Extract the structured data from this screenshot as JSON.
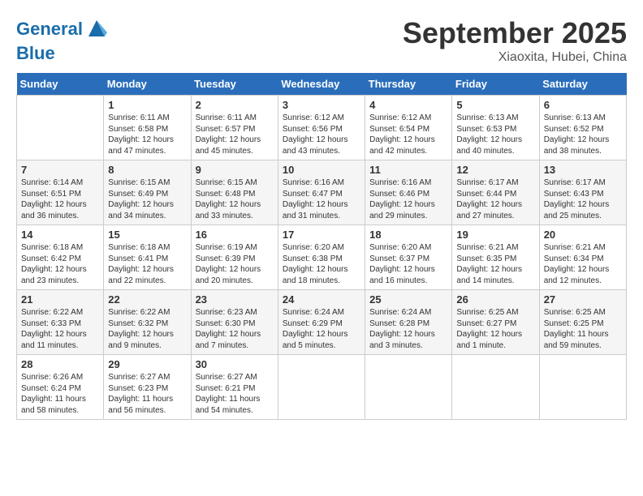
{
  "header": {
    "logo_line1": "General",
    "logo_line2": "Blue",
    "month": "September 2025",
    "location": "Xiaoxita, Hubei, China"
  },
  "days_of_week": [
    "Sunday",
    "Monday",
    "Tuesday",
    "Wednesday",
    "Thursday",
    "Friday",
    "Saturday"
  ],
  "weeks": [
    [
      {
        "num": "",
        "info": ""
      },
      {
        "num": "1",
        "info": "Sunrise: 6:11 AM\nSunset: 6:58 PM\nDaylight: 12 hours\nand 47 minutes."
      },
      {
        "num": "2",
        "info": "Sunrise: 6:11 AM\nSunset: 6:57 PM\nDaylight: 12 hours\nand 45 minutes."
      },
      {
        "num": "3",
        "info": "Sunrise: 6:12 AM\nSunset: 6:56 PM\nDaylight: 12 hours\nand 43 minutes."
      },
      {
        "num": "4",
        "info": "Sunrise: 6:12 AM\nSunset: 6:54 PM\nDaylight: 12 hours\nand 42 minutes."
      },
      {
        "num": "5",
        "info": "Sunrise: 6:13 AM\nSunset: 6:53 PM\nDaylight: 12 hours\nand 40 minutes."
      },
      {
        "num": "6",
        "info": "Sunrise: 6:13 AM\nSunset: 6:52 PM\nDaylight: 12 hours\nand 38 minutes."
      }
    ],
    [
      {
        "num": "7",
        "info": "Sunrise: 6:14 AM\nSunset: 6:51 PM\nDaylight: 12 hours\nand 36 minutes."
      },
      {
        "num": "8",
        "info": "Sunrise: 6:15 AM\nSunset: 6:49 PM\nDaylight: 12 hours\nand 34 minutes."
      },
      {
        "num": "9",
        "info": "Sunrise: 6:15 AM\nSunset: 6:48 PM\nDaylight: 12 hours\nand 33 minutes."
      },
      {
        "num": "10",
        "info": "Sunrise: 6:16 AM\nSunset: 6:47 PM\nDaylight: 12 hours\nand 31 minutes."
      },
      {
        "num": "11",
        "info": "Sunrise: 6:16 AM\nSunset: 6:46 PM\nDaylight: 12 hours\nand 29 minutes."
      },
      {
        "num": "12",
        "info": "Sunrise: 6:17 AM\nSunset: 6:44 PM\nDaylight: 12 hours\nand 27 minutes."
      },
      {
        "num": "13",
        "info": "Sunrise: 6:17 AM\nSunset: 6:43 PM\nDaylight: 12 hours\nand 25 minutes."
      }
    ],
    [
      {
        "num": "14",
        "info": "Sunrise: 6:18 AM\nSunset: 6:42 PM\nDaylight: 12 hours\nand 23 minutes."
      },
      {
        "num": "15",
        "info": "Sunrise: 6:18 AM\nSunset: 6:41 PM\nDaylight: 12 hours\nand 22 minutes."
      },
      {
        "num": "16",
        "info": "Sunrise: 6:19 AM\nSunset: 6:39 PM\nDaylight: 12 hours\nand 20 minutes."
      },
      {
        "num": "17",
        "info": "Sunrise: 6:20 AM\nSunset: 6:38 PM\nDaylight: 12 hours\nand 18 minutes."
      },
      {
        "num": "18",
        "info": "Sunrise: 6:20 AM\nSunset: 6:37 PM\nDaylight: 12 hours\nand 16 minutes."
      },
      {
        "num": "19",
        "info": "Sunrise: 6:21 AM\nSunset: 6:35 PM\nDaylight: 12 hours\nand 14 minutes."
      },
      {
        "num": "20",
        "info": "Sunrise: 6:21 AM\nSunset: 6:34 PM\nDaylight: 12 hours\nand 12 minutes."
      }
    ],
    [
      {
        "num": "21",
        "info": "Sunrise: 6:22 AM\nSunset: 6:33 PM\nDaylight: 12 hours\nand 11 minutes."
      },
      {
        "num": "22",
        "info": "Sunrise: 6:22 AM\nSunset: 6:32 PM\nDaylight: 12 hours\nand 9 minutes."
      },
      {
        "num": "23",
        "info": "Sunrise: 6:23 AM\nSunset: 6:30 PM\nDaylight: 12 hours\nand 7 minutes."
      },
      {
        "num": "24",
        "info": "Sunrise: 6:24 AM\nSunset: 6:29 PM\nDaylight: 12 hours\nand 5 minutes."
      },
      {
        "num": "25",
        "info": "Sunrise: 6:24 AM\nSunset: 6:28 PM\nDaylight: 12 hours\nand 3 minutes."
      },
      {
        "num": "26",
        "info": "Sunrise: 6:25 AM\nSunset: 6:27 PM\nDaylight: 12 hours\nand 1 minute."
      },
      {
        "num": "27",
        "info": "Sunrise: 6:25 AM\nSunset: 6:25 PM\nDaylight: 11 hours\nand 59 minutes."
      }
    ],
    [
      {
        "num": "28",
        "info": "Sunrise: 6:26 AM\nSunset: 6:24 PM\nDaylight: 11 hours\nand 58 minutes."
      },
      {
        "num": "29",
        "info": "Sunrise: 6:27 AM\nSunset: 6:23 PM\nDaylight: 11 hours\nand 56 minutes."
      },
      {
        "num": "30",
        "info": "Sunrise: 6:27 AM\nSunset: 6:21 PM\nDaylight: 11 hours\nand 54 minutes."
      },
      {
        "num": "",
        "info": ""
      },
      {
        "num": "",
        "info": ""
      },
      {
        "num": "",
        "info": ""
      },
      {
        "num": "",
        "info": ""
      }
    ]
  ]
}
